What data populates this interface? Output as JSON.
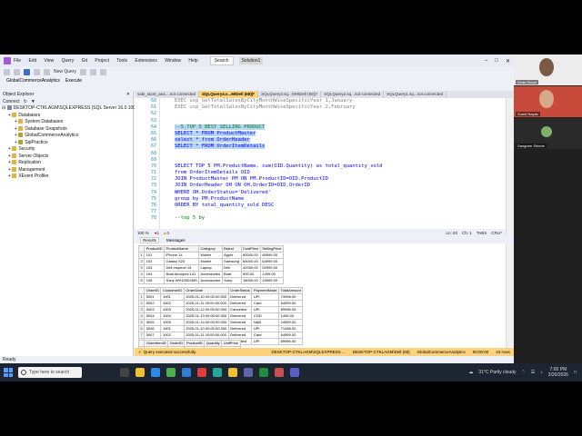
{
  "titlebar": {
    "menu": [
      "File",
      "Edit",
      "View",
      "Query",
      "Git",
      "Project",
      "Tools",
      "Extensions",
      "Window",
      "Help"
    ],
    "search_label": "Search",
    "solution_label": "Solution1"
  },
  "toolbar": {
    "new_query_label": "New Query",
    "database_dropdown": "GlobalCommerceAnalytics",
    "execute_label": "Execute"
  },
  "object_explorer": {
    "title": "Object Explorer",
    "connect_label": "Connect",
    "server": "DESKTOP-CTKLAGM\\SQLEXPRESS (SQL Server 16.0.1000",
    "items": [
      {
        "label": "Databases",
        "indent": 1,
        "kind": "folder"
      },
      {
        "label": "System Databases",
        "indent": 2,
        "kind": "folder"
      },
      {
        "label": "Database Snapshots",
        "indent": 2,
        "kind": "folder"
      },
      {
        "label": "GlobalCommerceAnalytics",
        "indent": 2,
        "kind": "db"
      },
      {
        "label": "SqlPractice",
        "indent": 2,
        "kind": "db"
      },
      {
        "label": "Security",
        "indent": 1,
        "kind": "folder"
      },
      {
        "label": "Server Objects",
        "indent": 1,
        "kind": "folder"
      },
      {
        "label": "Replication",
        "indent": 1,
        "kind": "folder"
      },
      {
        "label": "Management",
        "indent": 1,
        "kind": "folder"
      },
      {
        "label": "XEvent Profiler",
        "indent": 1,
        "kind": "folder"
      }
    ]
  },
  "tabs": [
    {
      "label": "sale_store_ana....not connected",
      "active": false
    },
    {
      "label": "SQLQuery4.s...M\\Dell (68))*",
      "active": true
    },
    {
      "label": "SQLQuery3.sq...GM\\Dell (59))*",
      "active": false
    },
    {
      "label": "SQLQuery2.sq...not connected",
      "active": false
    },
    {
      "label": "SQLQuery1.sq...not connected",
      "active": false
    }
  ],
  "editor": {
    "line_numbers": [
      "60",
      "61",
      "62",
      "63",
      "64",
      "65",
      "66",
      "67",
      "68",
      "69",
      "70",
      "71",
      "72",
      "73",
      "74",
      "75",
      "76",
      "77",
      "78"
    ],
    "lines": [
      {
        "text": "EXEC usp_GetTotalSalesByCityMonthWiseSpecificYear 1,January",
        "style": "gr",
        "sel": false
      },
      {
        "text": "EXEC usp_GetTotalSalesByCityMonthWiseSpecificYear 2,February",
        "style": "gr",
        "sel": false
      },
      {
        "text": "",
        "style": "",
        "sel": false
      },
      {
        "text": "",
        "style": "",
        "sel": false
      },
      {
        "text": "--5.TOP 5 BEST SELLING PRODUCT",
        "style": "cm",
        "sel": true
      },
      {
        "text": "SELECT * FROM ProductMaster",
        "style": "kw",
        "sel": true
      },
      {
        "text": "select * from OrderHeader",
        "style": "kw",
        "sel": true
      },
      {
        "text": "SELECT * FROM OrderItemDetails",
        "style": "kw",
        "sel": true
      },
      {
        "text": "",
        "style": "",
        "sel": false
      },
      {
        "text": "",
        "style": "",
        "sel": false
      },
      {
        "text": "SELECT TOP 5 PM.ProductName, sum(OID.Quantity) as total_quantity_sold",
        "style": "mix",
        "sel": false
      },
      {
        "text": "from OrderItemDetails OID",
        "style": "kw",
        "sel": false
      },
      {
        "text": "JOIN ProductMaster PM ON PM.ProductID=OID.ProductID",
        "style": "kw",
        "sel": false
      },
      {
        "text": "JOIN OrderHeader OH ON OH.OrderID=OID.OrderID",
        "style": "kw",
        "sel": false
      },
      {
        "text": "WHERE OH.OrderStatus='Delivered'",
        "style": "mixs",
        "sel": false
      },
      {
        "text": "group by PM.ProductName",
        "style": "kw",
        "sel": false
      },
      {
        "text": "ORDER BY total_quantity_sold DESC",
        "style": "kw",
        "sel": false
      },
      {
        "text": "",
        "style": "",
        "sel": false
      },
      {
        "text": "--top 5 by",
        "style": "cm",
        "sel": false
      }
    ],
    "zoom": "100 %",
    "errors": "1",
    "warnings": "0",
    "position": {
      "ln": "Ln: 63",
      "ch": "Ch: 1",
      "enc": "TABS",
      "lf": "CRLF"
    }
  },
  "results_tabs": {
    "results": "Results",
    "messages": "Messages"
  },
  "grid1": {
    "columns": [
      "ProductID",
      "ProductName",
      "Category",
      "Brand",
      "CostPrice",
      "SellingPrice"
    ],
    "rows": [
      [
        "1",
        "101",
        "iPhone 14",
        "Mobile",
        "Apple",
        "80000.00",
        "89999.00"
      ],
      [
        "2",
        "102",
        "Galaxy S23",
        "Mobile",
        "Samsung",
        "65000.00",
        "64999.00"
      ],
      [
        "3",
        "103",
        "Dell Inspiron 15",
        "Laptop",
        "Dell",
        "42000.00",
        "52999.00"
      ],
      [
        "4",
        "104",
        "Boat Airdopes 141",
        "Accessories",
        "Boat",
        "900.00",
        "1499.00"
      ],
      [
        "5",
        "105",
        "Sony WH1000XM5",
        "Accessories",
        "Sony",
        "18000.00",
        "24999.00"
      ]
    ]
  },
  "grid2": {
    "columns": [
      "OrderID",
      "CustomerID",
      "OrderDate",
      "OrderStatus",
      "PaymentMode",
      "TotalAmount"
    ],
    "rows": [
      [
        "1",
        "5001",
        "1001",
        "2025-01-10 00:00:00.000",
        "Delivered",
        "UPI",
        "73998.00"
      ],
      [
        "2",
        "5002",
        "1002",
        "2025-01-11 00:00:00.000",
        "Delivered",
        "Card",
        "64999.00"
      ],
      [
        "3",
        "5003",
        "1003",
        "2025-01-12 00:00:00.000",
        "Cancelled",
        "UPI",
        "89996.00"
      ],
      [
        "4",
        "5004",
        "1004",
        "2025-01-13 00:00:00.000",
        "Delivered",
        "COD",
        "1499.00"
      ],
      [
        "5",
        "5005",
        "1005",
        "2025-01-14 00:00:00.000",
        "Delivered",
        "N&B",
        "24999.00"
      ],
      [
        "6",
        "5006",
        "1001",
        "2025-01-10 00:00:00.000",
        "Delivered",
        "UPI",
        "71498.00"
      ],
      [
        "7",
        "5007",
        "1002",
        "2025-01-11 00:00:00.000",
        "Delivered",
        "Card",
        "64999.00"
      ],
      [
        "8",
        "5008",
        "1003",
        "2026-01-12 00:00:00.000",
        "Cancelled",
        "UPI",
        "89996.00"
      ]
    ]
  },
  "grid3": {
    "columns": [
      "OrderItemID",
      "OrderID",
      "ProductID",
      "Quantity",
      "UnitPrice"
    ],
    "rows": [
      [
        "1",
        "1",
        "5001",
        "101",
        "1",
        "69999.00"
      ]
    ]
  },
  "query_status": {
    "message": "Query executed successfully.",
    "server": "DESKTOP-CTKLAGM\\SQLEXPRESS ...",
    "user": "DESKTOP-CTKLAGM\\Dell (68)",
    "db": "GlobalCommerceAnalytics",
    "time": "00:00:00",
    "rows": "44 rows"
  },
  "status_ready": "Ready",
  "participants": [
    {
      "name": "Kiran Rauni",
      "bg": "#ececec"
    },
    {
      "name": "Sumit Nayak",
      "bg": "#c84a3a"
    },
    {
      "name": "Sangram Shinde",
      "bg": "#2a2a2a"
    }
  ],
  "taskbar": {
    "search_placeholder": "Type here to search",
    "weather": "31°C  Partly cloudy",
    "time": "7:00 PM",
    "date": "2/20/2026"
  },
  "colors": {
    "accent": "#fcd37a",
    "selection": "#b5d5ff",
    "keyword": "#0000ff",
    "comment": "#008000",
    "string": "#c00000"
  }
}
